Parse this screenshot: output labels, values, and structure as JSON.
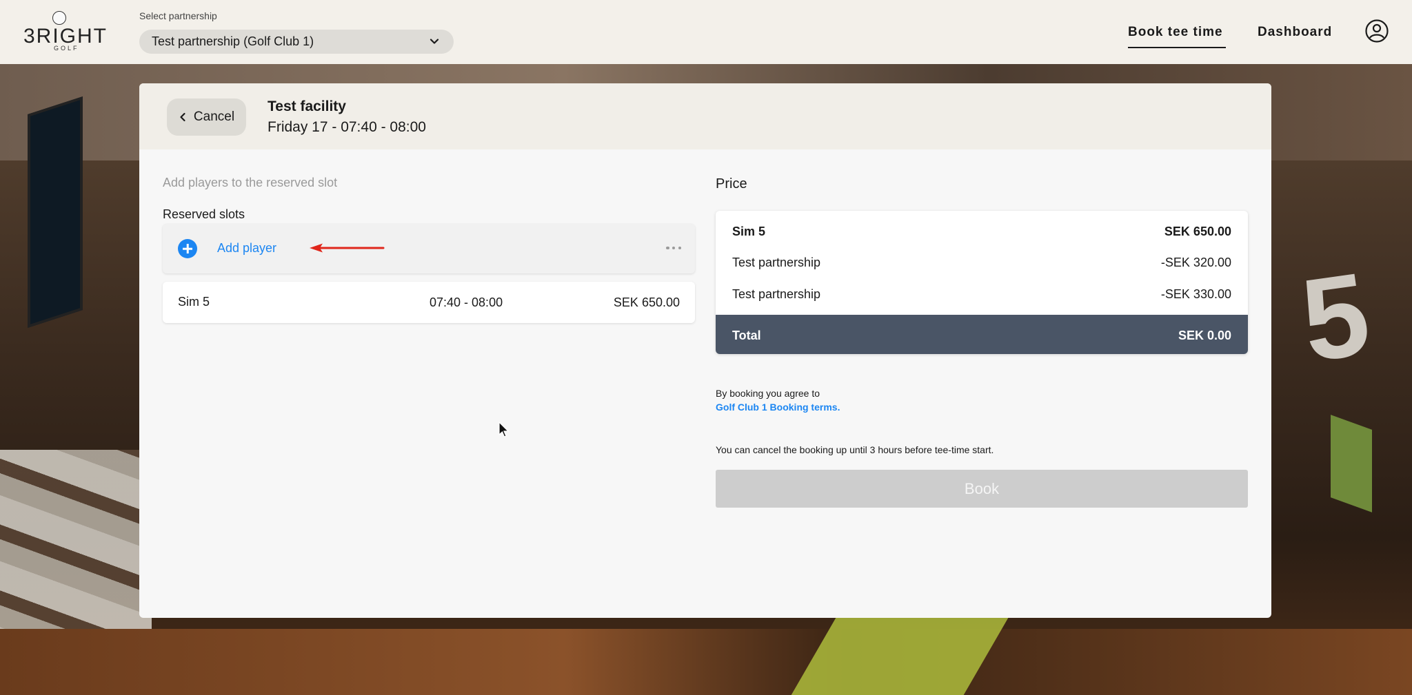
{
  "header": {
    "logo_word": "3RIGHT",
    "logo_sub": "GOLF",
    "partner_label": "Select partnership",
    "partner_value": "Test partnership (Golf Club 1)",
    "nav": {
      "book": "Book tee time",
      "dashboard": "Dashboard"
    },
    "icons": {
      "avatar": "user-circle-icon",
      "dropdown": "chevron-down-icon"
    }
  },
  "booking": {
    "cancel_label": "Cancel",
    "facility": "Test facility",
    "slot": "Friday 17 - 07:40 - 08:00",
    "hint": "Add players to the reserved slot",
    "reserved_label": "Reserved slots",
    "add_player": "Add player",
    "slot_row": {
      "name": "Sim 5",
      "time": "07:40 - 08:00",
      "price": "SEK 650.00"
    }
  },
  "price": {
    "title": "Price",
    "lines": [
      {
        "label": "Sim 5",
        "amount": "SEK 650.00",
        "bold": true
      },
      {
        "label": "Test partnership",
        "amount": "-SEK 320.00",
        "bold": false
      },
      {
        "label": "Test partnership",
        "amount": "-SEK 330.00",
        "bold": false
      }
    ],
    "total_label": "Total",
    "total_amount": "SEK 0.00"
  },
  "terms": {
    "text": "By booking you agree to",
    "link": "Golf Club 1 Booking terms.",
    "cancel_note": "You can cancel the booking up until 3 hours before tee-time start."
  },
  "book_button": "Book",
  "colors": {
    "accent": "#1c86f2",
    "total_bar": "#4a5566",
    "arrow": "#e0261b",
    "disabled_button": "#cdcdcd"
  }
}
